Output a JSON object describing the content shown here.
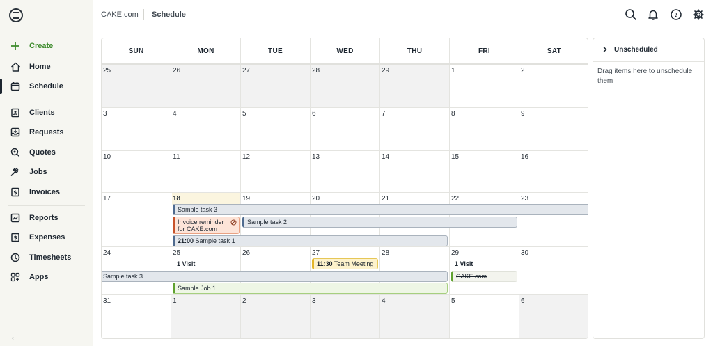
{
  "sidebar": {
    "items": [
      {
        "key": "create",
        "label": "Create",
        "icon": "plus-icon"
      },
      {
        "key": "home",
        "label": "Home",
        "icon": "home-icon"
      },
      {
        "key": "schedule",
        "label": "Schedule",
        "icon": "calendar-icon"
      },
      {
        "key": "clients",
        "label": "Clients",
        "icon": "contact-card-icon"
      },
      {
        "key": "requests",
        "label": "Requests",
        "icon": "inbox-icon"
      },
      {
        "key": "quotes",
        "label": "Quotes",
        "icon": "quote-icon"
      },
      {
        "key": "jobs",
        "label": "Jobs",
        "icon": "hammer-icon"
      },
      {
        "key": "invoices",
        "label": "Invoices",
        "icon": "invoice-icon"
      },
      {
        "key": "reports",
        "label": "Reports",
        "icon": "chart-icon"
      },
      {
        "key": "expenses",
        "label": "Expenses",
        "icon": "dollar-icon"
      },
      {
        "key": "timesheets",
        "label": "Timesheets",
        "icon": "clock-icon"
      },
      {
        "key": "apps",
        "label": "Apps",
        "icon": "apps-icon"
      }
    ],
    "collapse_glyph": "←"
  },
  "header": {
    "company": "CAKE.com",
    "page": "Schedule"
  },
  "calendar": {
    "days": [
      "SUN",
      "MON",
      "TUE",
      "WED",
      "THU",
      "FRI",
      "SAT"
    ],
    "weeks": [
      [
        "25",
        "26",
        "27",
        "28",
        "29",
        "1",
        "2"
      ],
      [
        "3",
        "4",
        "5",
        "6",
        "7",
        "8",
        "9"
      ],
      [
        "10",
        "11",
        "12",
        "13",
        "14",
        "15",
        "16"
      ],
      [
        "17",
        "18",
        "19",
        "20",
        "21",
        "22",
        "23"
      ],
      [
        "24",
        "25",
        "26",
        "27",
        "28",
        "29",
        "30"
      ],
      [
        "31",
        "1",
        "2",
        "3",
        "4",
        "5",
        "6"
      ]
    ],
    "events": {
      "task3_w4": "Sample task 3",
      "invoice": "Invoice reminder for CAKE.com",
      "task2": "Sample task 2",
      "task1_time": "21:00",
      "task1": "Sample task 1",
      "meeting_time": "11:30",
      "meeting": "Team Meeting",
      "task3_w5": "Sample task 3",
      "job1": "Sample Job 1",
      "done_fri": "CAKE.com",
      "visits_mon": "1 Visit",
      "visits_fri": "1 Visit"
    }
  },
  "unscheduled": {
    "title": "Unscheduled",
    "hint": "Drag items here to unschedule them"
  },
  "colors": {
    "accent_green": "#3e8b2d",
    "task_blue": "#4f6b8f",
    "job_green": "#5fa12f",
    "meeting_yellow": "#e3b62b",
    "invoice_red": "#c8522a"
  }
}
